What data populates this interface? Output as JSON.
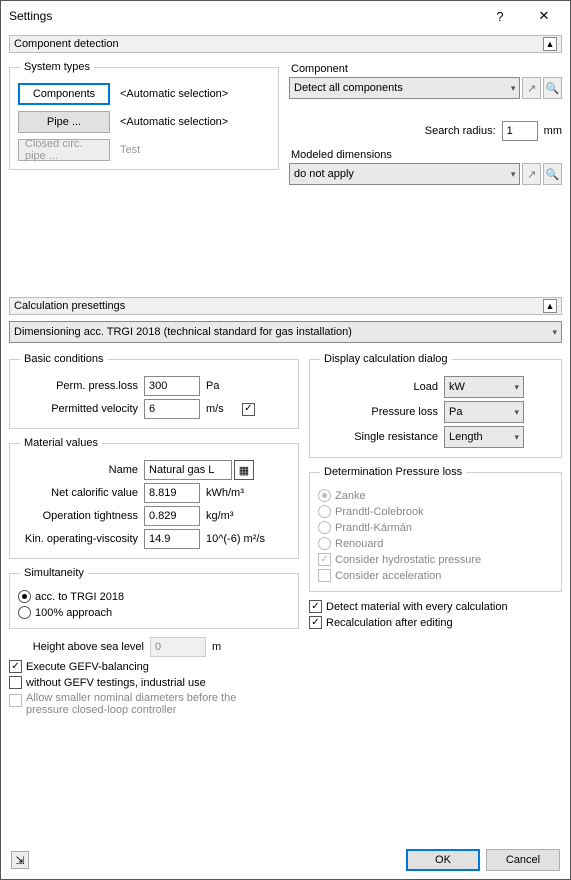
{
  "window": {
    "title": "Settings",
    "help": "?",
    "close": "✕"
  },
  "compDetect": {
    "title": "Component detection",
    "systemTypes": {
      "legend": "System types",
      "components": "Components",
      "componentsNote": "<Automatic selection>",
      "pipe": "Pipe ...",
      "pipeNote": "<Automatic selection>",
      "closed": "Closed circ. pipe ...",
      "closedNote": "Test"
    },
    "component": {
      "legend": "Component",
      "detect": "Detect all components",
      "searchRadiusLbl": "Search radius:",
      "searchRadius": "1",
      "searchUnit": "mm",
      "modeledLbl": "Modeled dimensions",
      "modeled": "do not apply"
    }
  },
  "calc": {
    "title": "Calculation presettings",
    "dimensioning": "Dimensioning acc. TRGI 2018 (technical standard for gas installation)",
    "basic": {
      "legend": "Basic conditions",
      "permPressLbl": "Perm. press.loss",
      "permPress": "300",
      "permPressUnit": "Pa",
      "permVelLbl": "Permitted velocity",
      "permVel": "6",
      "permVelUnit": "m/s"
    },
    "material": {
      "legend": "Material values",
      "nameLbl": "Name",
      "name": "Natural gas L",
      "netLbl": "Net calorific value",
      "net": "8.819",
      "netUnit": "kWh/m³",
      "tightLbl": "Operation tightness",
      "tight": "0.829",
      "tightUnit": "kg/m³",
      "viscLbl": "Kin. operating-viscosity",
      "visc": "14.9",
      "viscUnit": "10^(-6) m²/s"
    },
    "sim": {
      "legend": "Simultaneity",
      "trgi": "acc. to TRGI 2018",
      "full": "100% approach"
    },
    "heightLbl": "Height above sea level",
    "height": "0",
    "heightUnit": "m",
    "gefv": "Execute GEFV-balancing",
    "without": "without GEFV testings, industrial use",
    "smaller": "Allow smaller nominal diameters before the pressure closed-loop controller",
    "display": {
      "legend": "Display calculation dialog",
      "loadLbl": "Load",
      "load": "kW",
      "pressLbl": "Pressure loss",
      "press": "Pa",
      "resLbl": "Single resistance",
      "res": "Length"
    },
    "det": {
      "legend": "Determination Pressure loss",
      "zanke": "Zanke",
      "pc": "Prandtl-Colebrook",
      "pk": "Prandtl-Kármán",
      "ren": "Renouard",
      "hydro": "Consider hydrostatic pressure",
      "accel": "Consider acceleration"
    },
    "detect": "Detect material with every calculation",
    "recalc": "Recalculation after editing"
  },
  "footer": {
    "ok": "OK",
    "cancel": "Cancel"
  }
}
